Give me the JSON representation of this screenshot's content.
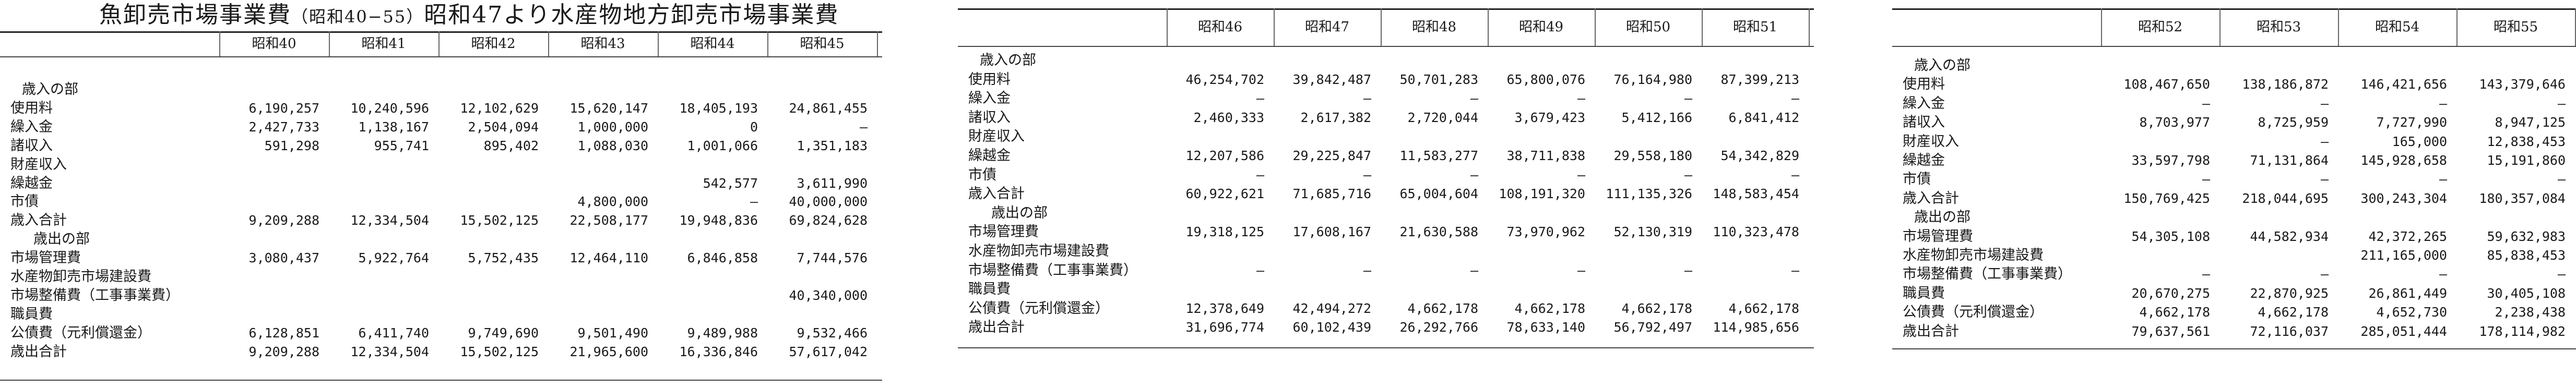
{
  "title": {
    "main_left": "魚卸売市場事業費",
    "range": "（昭和40−55）",
    "main_right": "昭和47より水産物地方卸売市場事業費"
  },
  "panels": [
    {
      "columns": [
        "昭和40",
        "昭和41",
        "昭和42",
        "昭和43",
        "昭和44",
        "昭和45"
      ],
      "rows": [
        {
          "label": "歳入の部",
          "indent": 1,
          "values": [
            "",
            "",
            "",
            "",
            "",
            ""
          ]
        },
        {
          "label": "使用料",
          "indent": 0,
          "values": [
            "6,190,257",
            "10,240,596",
            "12,102,629",
            "15,620,147",
            "18,405,193",
            "24,861,455"
          ]
        },
        {
          "label": "繰入金",
          "indent": 0,
          "values": [
            "2,427,733",
            "1,138,167",
            "2,504,094",
            "1,000,000",
            "0",
            "—"
          ]
        },
        {
          "label": "諸収入",
          "indent": 0,
          "values": [
            "591,298",
            "955,741",
            "895,402",
            "1,088,030",
            "1,001,066",
            "1,351,183"
          ]
        },
        {
          "label": "財産収入",
          "indent": 0,
          "values": [
            "",
            "",
            "",
            "",
            "",
            ""
          ]
        },
        {
          "label": "繰越金",
          "indent": 0,
          "values": [
            "",
            "",
            "",
            "",
            "542,577",
            "3,611,990"
          ]
        },
        {
          "label": "市債",
          "indent": 0,
          "values": [
            "",
            "",
            "",
            "4,800,000",
            "—",
            "40,000,000"
          ]
        },
        {
          "label": "歳入合計",
          "indent": 0,
          "values": [
            "9,209,288",
            "12,334,504",
            "15,502,125",
            "22,508,177",
            "19,948,836",
            "69,824,628"
          ]
        },
        {
          "label": "歳出の部",
          "indent": 2,
          "values": [
            "",
            "",
            "",
            "",
            "",
            ""
          ]
        },
        {
          "label": "市場管理費",
          "indent": 0,
          "values": [
            "3,080,437",
            "5,922,764",
            "5,752,435",
            "12,464,110",
            "6,846,858",
            "7,744,576"
          ]
        },
        {
          "label": "水産物卸売市場建設費",
          "indent": 0,
          "values": [
            "",
            "",
            "",
            "",
            "",
            ""
          ]
        },
        {
          "label": "市場整備費（工事事業費）",
          "indent": 0,
          "values": [
            "",
            "",
            "",
            "",
            "",
            "40,340,000"
          ]
        },
        {
          "label": "職員費",
          "indent": 0,
          "values": [
            "",
            "",
            "",
            "",
            "",
            ""
          ]
        },
        {
          "label": "公債費（元利償還金）",
          "indent": 0,
          "values": [
            "6,128,851",
            "6,411,740",
            "9,749,690",
            "9,501,490",
            "9,489,988",
            "9,532,466"
          ]
        },
        {
          "label": "歳出合計",
          "indent": 0,
          "values": [
            "9,209,288",
            "12,334,504",
            "15,502,125",
            "21,965,600",
            "16,336,846",
            "57,617,042"
          ]
        }
      ]
    },
    {
      "columns": [
        "昭和46",
        "昭和47",
        "昭和48",
        "昭和49",
        "昭和50",
        "昭和51"
      ],
      "rows": [
        {
          "label": "歳入の部",
          "indent": 1,
          "values": [
            "",
            "",
            "",
            "",
            "",
            ""
          ]
        },
        {
          "label": "使用料",
          "indent": 0,
          "values": [
            "46,254,702",
            "39,842,487",
            "50,701,283",
            "65,800,076",
            "76,164,980",
            "87,399,213"
          ]
        },
        {
          "label": "繰入金",
          "indent": 0,
          "values": [
            "—",
            "—",
            "—",
            "—",
            "—",
            "—"
          ]
        },
        {
          "label": "諸収入",
          "indent": 0,
          "values": [
            "2,460,333",
            "2,617,382",
            "2,720,044",
            "3,679,423",
            "5,412,166",
            "6,841,412"
          ]
        },
        {
          "label": "財産収入",
          "indent": 0,
          "values": [
            "",
            "",
            "",
            "",
            "",
            ""
          ]
        },
        {
          "label": "繰越金",
          "indent": 0,
          "values": [
            "12,207,586",
            "29,225,847",
            "11,583,277",
            "38,711,838",
            "29,558,180",
            "54,342,829"
          ]
        },
        {
          "label": "市債",
          "indent": 0,
          "values": [
            "—",
            "—",
            "—",
            "—",
            "—",
            "—"
          ]
        },
        {
          "label": "歳入合計",
          "indent": 0,
          "values": [
            "60,922,621",
            "71,685,716",
            "65,004,604",
            "108,191,320",
            "111,135,326",
            "148,583,454"
          ]
        },
        {
          "label": "歳出の部",
          "indent": 2,
          "values": [
            "",
            "",
            "",
            "",
            "",
            ""
          ]
        },
        {
          "label": "市場管理費",
          "indent": 0,
          "values": [
            "19,318,125",
            "17,608,167",
            "21,630,588",
            "73,970,962",
            "52,130,319",
            "110,323,478"
          ]
        },
        {
          "label": "水産物卸売市場建設費",
          "indent": 0,
          "values": [
            "",
            "",
            "",
            "",
            "",
            ""
          ]
        },
        {
          "label": "市場整備費（工事事業費）",
          "indent": 0,
          "values": [
            "—",
            "—",
            "—",
            "—",
            "—",
            "—"
          ]
        },
        {
          "label": "職員費",
          "indent": 0,
          "values": [
            "",
            "",
            "",
            "",
            "",
            ""
          ]
        },
        {
          "label": "公債費（元利償還金）",
          "indent": 0,
          "values": [
            "12,378,649",
            "42,494,272",
            "4,662,178",
            "4,662,178",
            "4,662,178",
            "4,662,178"
          ]
        },
        {
          "label": "歳出合計",
          "indent": 0,
          "values": [
            "31,696,774",
            "60,102,439",
            "26,292,766",
            "78,633,140",
            "56,792,497",
            "114,985,656"
          ]
        }
      ]
    },
    {
      "columns": [
        "昭和52",
        "昭和53",
        "昭和54",
        "昭和55"
      ],
      "rows": [
        {
          "label": "歳入の部",
          "indent": 1,
          "values": [
            "",
            "",
            "",
            ""
          ]
        },
        {
          "label": "使用料",
          "indent": 0,
          "values": [
            "108,467,650",
            "138,186,872",
            "146,421,656",
            "143,379,646"
          ]
        },
        {
          "label": "繰入金",
          "indent": 0,
          "values": [
            "—",
            "—",
            "—",
            "—"
          ]
        },
        {
          "label": "諸収入",
          "indent": 0,
          "values": [
            "8,703,977",
            "8,725,959",
            "7,727,990",
            "8,947,125"
          ]
        },
        {
          "label": "財産収入",
          "indent": 0,
          "values": [
            "",
            "—",
            "165,000",
            "12,838,453"
          ]
        },
        {
          "label": "繰越金",
          "indent": 0,
          "values": [
            "33,597,798",
            "71,131,864",
            "145,928,658",
            "15,191,860"
          ]
        },
        {
          "label": "市債",
          "indent": 0,
          "values": [
            "—",
            "—",
            "—",
            "—"
          ]
        },
        {
          "label": "歳入合計",
          "indent": 0,
          "values": [
            "150,769,425",
            "218,044,695",
            "300,243,304",
            "180,357,084"
          ]
        },
        {
          "label": "歳出の部",
          "indent": 1,
          "values": [
            "",
            "",
            "",
            ""
          ]
        },
        {
          "label": "市場管理費",
          "indent": 0,
          "values": [
            "54,305,108",
            "44,582,934",
            "42,372,265",
            "59,632,983"
          ]
        },
        {
          "label": "水産物卸売市場建設費",
          "indent": 0,
          "values": [
            "",
            "",
            "211,165,000",
            "85,838,453"
          ]
        },
        {
          "label": "市場整備費（工事事業費）",
          "indent": 0,
          "values": [
            "—",
            "—",
            "—",
            "—"
          ]
        },
        {
          "label": "職員費",
          "indent": 0,
          "values": [
            "20,670,275",
            "22,870,925",
            "26,861,449",
            "30,405,108"
          ]
        },
        {
          "label": "公債費（元利償還金）",
          "indent": 0,
          "values": [
            "4,662,178",
            "4,662,178",
            "4,652,730",
            "2,238,438"
          ]
        },
        {
          "label": "歳出合計",
          "indent": 0,
          "values": [
            "79,637,561",
            "72,116,037",
            "285,051,444",
            "178,114,982"
          ]
        }
      ]
    }
  ]
}
